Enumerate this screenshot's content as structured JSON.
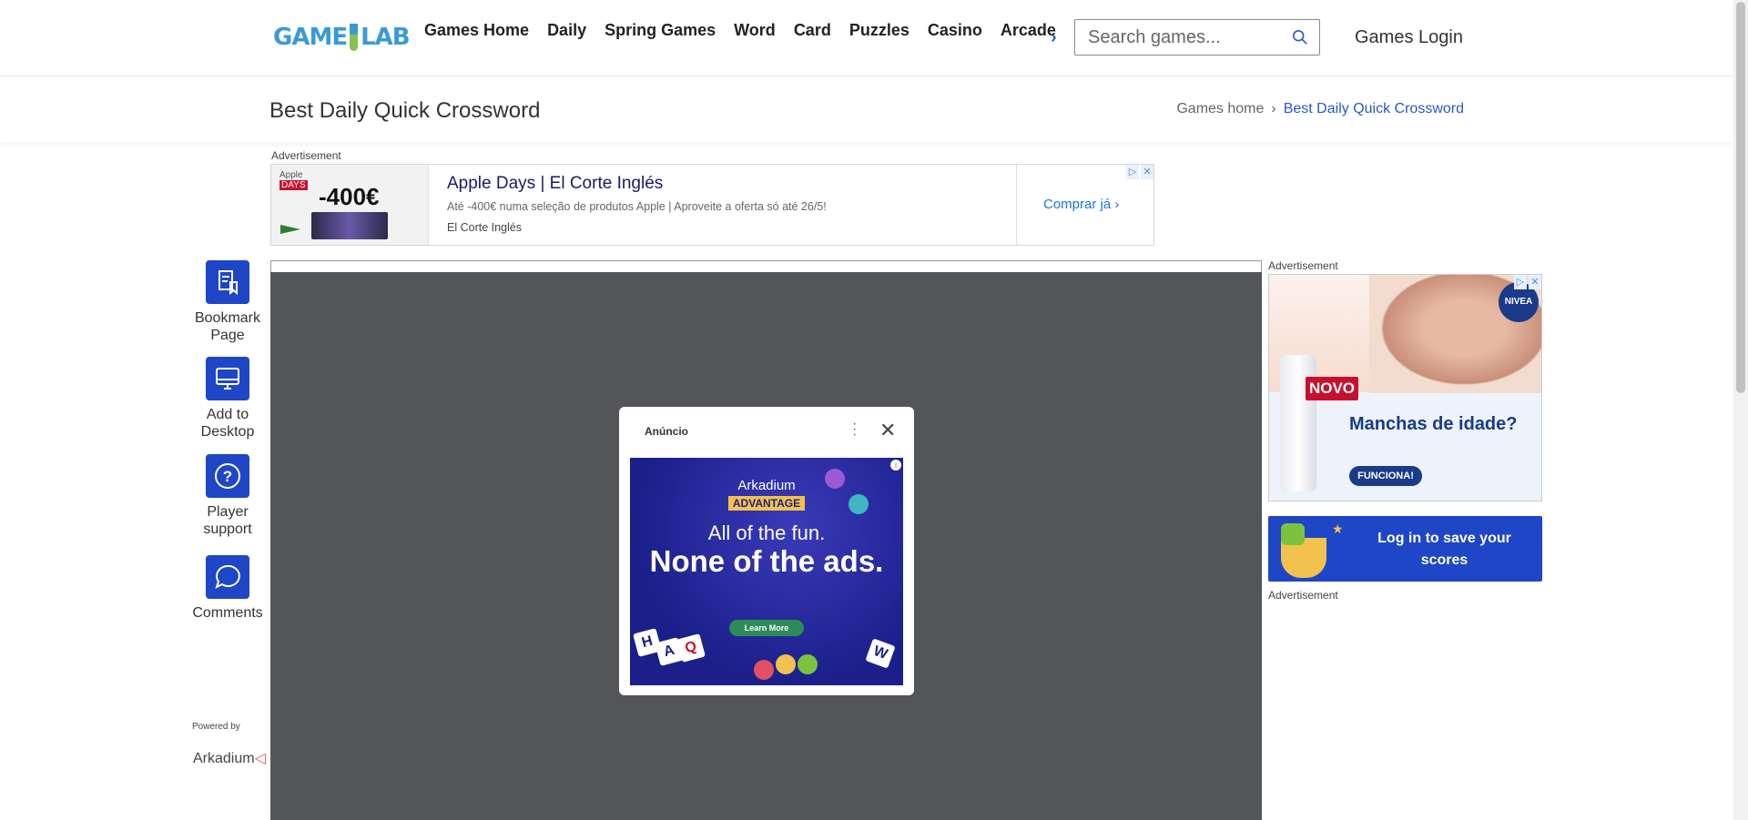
{
  "header": {
    "logo_left": "GAME",
    "logo_right": "LAB",
    "nav_items": [
      "Games Home",
      "Daily",
      "Spring Games",
      "Word",
      "Card",
      "Puzzles",
      "Casino",
      "Arcade"
    ],
    "search_placeholder": "Search games...",
    "login_label": "Games Login"
  },
  "titlebar": {
    "title": "Best Daily Quick Crossword",
    "breadcrumb_home": "Games home",
    "breadcrumb_current": "Best Daily Quick Crossword"
  },
  "ad_label": "Advertisement",
  "top_ad": {
    "brand_tag": "Apple",
    "brand_days": "DAYS",
    "price": "-400€",
    "headline": "Apple Days | El Corte Inglés",
    "description": "Até -400€ numa seleção de produtos Apple | Aproveite a oferta só até 26/5!",
    "advertiser": "El Corte Inglés",
    "cta": "Comprar já"
  },
  "sidebar": {
    "tools": [
      {
        "label": "Bookmark Page",
        "icon": "bookmark-icon"
      },
      {
        "label": "Add to Desktop",
        "icon": "desktop-icon"
      },
      {
        "label": "Player support",
        "icon": "question-icon"
      },
      {
        "label": "Comments",
        "icon": "comment-icon"
      }
    ],
    "powered_by": "Powered by",
    "powered_brand": "Arkadium"
  },
  "modal": {
    "label": "Anúncio",
    "brand": "Arkadium",
    "badge": "ADVANTAGE",
    "line1": "All of the fun.",
    "line2": "None of the ads.",
    "button": "Learn More",
    "tiles": [
      "H",
      "A",
      "Q",
      "W"
    ]
  },
  "side_ad": {
    "brand": "NIVEA",
    "badge": "NOVO",
    "headline": "Manchas de idade?",
    "cta": "FUNCIONA!"
  },
  "save_box": {
    "text": "Log in to save your scores"
  },
  "colors": {
    "accent": "#1e46c6",
    "game_bg": "#535559",
    "link": "#2a58c9"
  }
}
